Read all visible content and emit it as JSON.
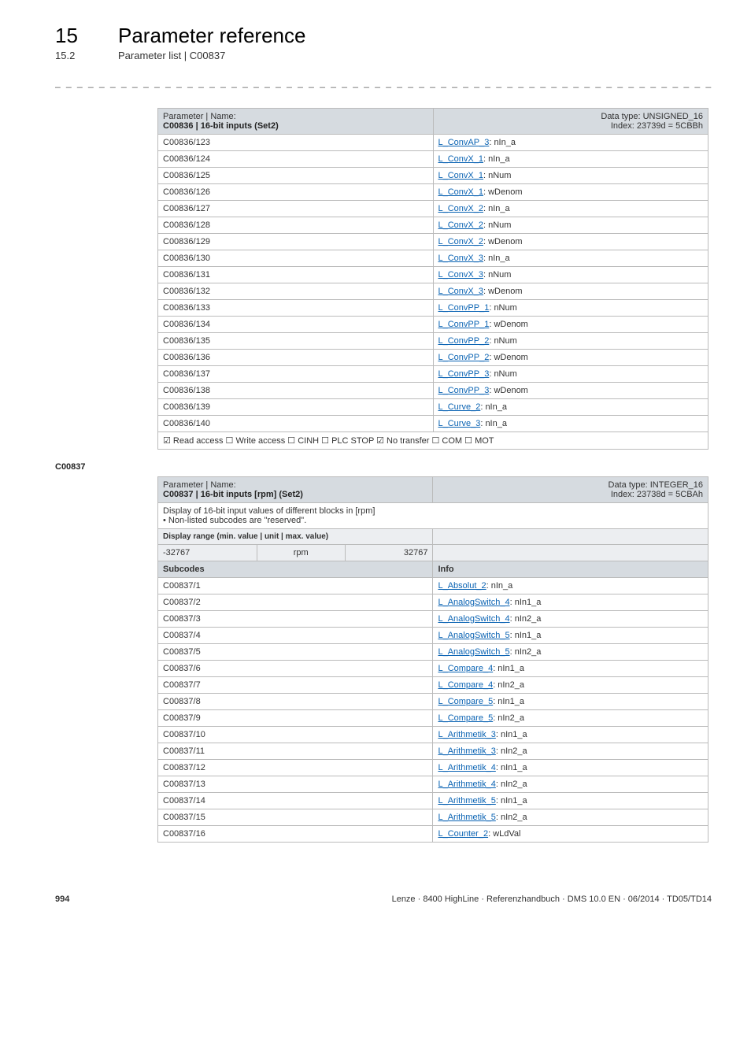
{
  "header": {
    "chapter_num": "15",
    "chapter_title": "Parameter reference",
    "section_num": "15.2",
    "section_title": "Parameter list | C00837"
  },
  "dashes": "_ _ _ _ _ _ _ _ _ _ _ _ _ _ _ _ _ _ _ _ _ _ _ _ _ _ _ _ _ _ _ _ _ _ _ _ _ _ _ _ _ _ _ _ _ _ _ _ _ _ _ _ _ _ _ _ _ _ _ _ _ _ _ _",
  "table1": {
    "param_label": "Parameter | Name:",
    "param_name": "C00836 | 16-bit inputs (Set2)",
    "dtype1": "Data type: UNSIGNED_16",
    "dtype2": "Index: 23739d = 5CBBh",
    "rows": [
      {
        "sub": "C00836/123",
        "link": "L_ConvAP_3",
        "rest": ": nIn_a"
      },
      {
        "sub": "C00836/124",
        "link": "L_ConvX_1",
        "rest": ": nIn_a"
      },
      {
        "sub": "C00836/125",
        "link": "L_ConvX_1",
        "rest": ": nNum"
      },
      {
        "sub": "C00836/126",
        "link": "L_ConvX_1",
        "rest": ": wDenom"
      },
      {
        "sub": "C00836/127",
        "link": "L_ConvX_2",
        "rest": ": nIn_a"
      },
      {
        "sub": "C00836/128",
        "link": "L_ConvX_2",
        "rest": ": nNum"
      },
      {
        "sub": "C00836/129",
        "link": "L_ConvX_2",
        "rest": ": wDenom"
      },
      {
        "sub": "C00836/130",
        "link": "L_ConvX_3",
        "rest": ": nIn_a"
      },
      {
        "sub": "C00836/131",
        "link": "L_ConvX_3",
        "rest": ": nNum"
      },
      {
        "sub": "C00836/132",
        "link": "L_ConvX_3",
        "rest": ": wDenom"
      },
      {
        "sub": "C00836/133",
        "link": "L_ConvPP_1",
        "rest": ": nNum"
      },
      {
        "sub": "C00836/134",
        "link": "L_ConvPP_1",
        "rest": ": wDenom"
      },
      {
        "sub": "C00836/135",
        "link": "L_ConvPP_2",
        "rest": ": nNum"
      },
      {
        "sub": "C00836/136",
        "link": "L_ConvPP_2",
        "rest": ": wDenom"
      },
      {
        "sub": "C00836/137",
        "link": "L_ConvPP_3",
        "rest": ": nNum"
      },
      {
        "sub": "C00836/138",
        "link": "L_ConvPP_3",
        "rest": ": wDenom"
      },
      {
        "sub": "C00836/139",
        "link": "L_Curve_2",
        "rest": ": nIn_a"
      },
      {
        "sub": "C00836/140",
        "link": "L_Curve_3",
        "rest": ": nIn_a"
      }
    ],
    "footer": "☑ Read access  ☐ Write access  ☐ CINH  ☐ PLC STOP  ☑ No transfer  ☐ COM  ☐ MOT"
  },
  "anchor": "C00837",
  "table2": {
    "param_label": "Parameter | Name:",
    "param_name": "C00837 | 16-bit inputs [rpm] (Set2)",
    "dtype1": "Data type: INTEGER_16",
    "dtype2": "Index: 23738d = 5CBAh",
    "desc1": "Display of 16-bit input values of different blocks in [rpm]",
    "desc2": "• Non-listed subcodes are \"reserved\".",
    "range_label": "Display range (min. value | unit | max. value)",
    "range_min": "-32767",
    "range_unit": "rpm",
    "range_max": "32767",
    "subcodes_label": "Subcodes",
    "info_label": "Info",
    "rows": [
      {
        "sub": "C00837/1",
        "link": "L_Absolut_2",
        "rest": ": nIn_a"
      },
      {
        "sub": "C00837/2",
        "link": "L_AnalogSwitch_4",
        "rest": ": nIn1_a"
      },
      {
        "sub": "C00837/3",
        "link": "L_AnalogSwitch_4",
        "rest": ": nIn2_a"
      },
      {
        "sub": "C00837/4",
        "link": "L_AnalogSwitch_5",
        "rest": ": nIn1_a"
      },
      {
        "sub": "C00837/5",
        "link": "L_AnalogSwitch_5",
        "rest": ": nIn2_a"
      },
      {
        "sub": "C00837/6",
        "link": "L_Compare_4",
        "rest": ": nIn1_a"
      },
      {
        "sub": "C00837/7",
        "link": "L_Compare_4",
        "rest": ": nIn2_a"
      },
      {
        "sub": "C00837/8",
        "link": "L_Compare_5",
        "rest": ": nIn1_a"
      },
      {
        "sub": "C00837/9",
        "link": "L_Compare_5",
        "rest": ": nIn2_a"
      },
      {
        "sub": "C00837/10",
        "link": "L_Arithmetik_3",
        "rest": ": nIn1_a"
      },
      {
        "sub": "C00837/11",
        "link": "L_Arithmetik_3",
        "rest": ": nIn2_a"
      },
      {
        "sub": "C00837/12",
        "link": "L_Arithmetik_4",
        "rest": ": nIn1_a"
      },
      {
        "sub": "C00837/13",
        "link": "L_Arithmetik_4",
        "rest": ": nIn2_a"
      },
      {
        "sub": "C00837/14",
        "link": "L_Arithmetik_5",
        "rest": ": nIn1_a"
      },
      {
        "sub": "C00837/15",
        "link": "L_Arithmetik_5",
        "rest": ": nIn2_a"
      },
      {
        "sub": "C00837/16",
        "link": "L_Counter_2",
        "rest": ": wLdVal"
      }
    ]
  },
  "footer": {
    "page": "994",
    "text": "Lenze · 8400 HighLine · Referenzhandbuch · DMS 10.0 EN · 06/2014 · TD05/TD14"
  }
}
